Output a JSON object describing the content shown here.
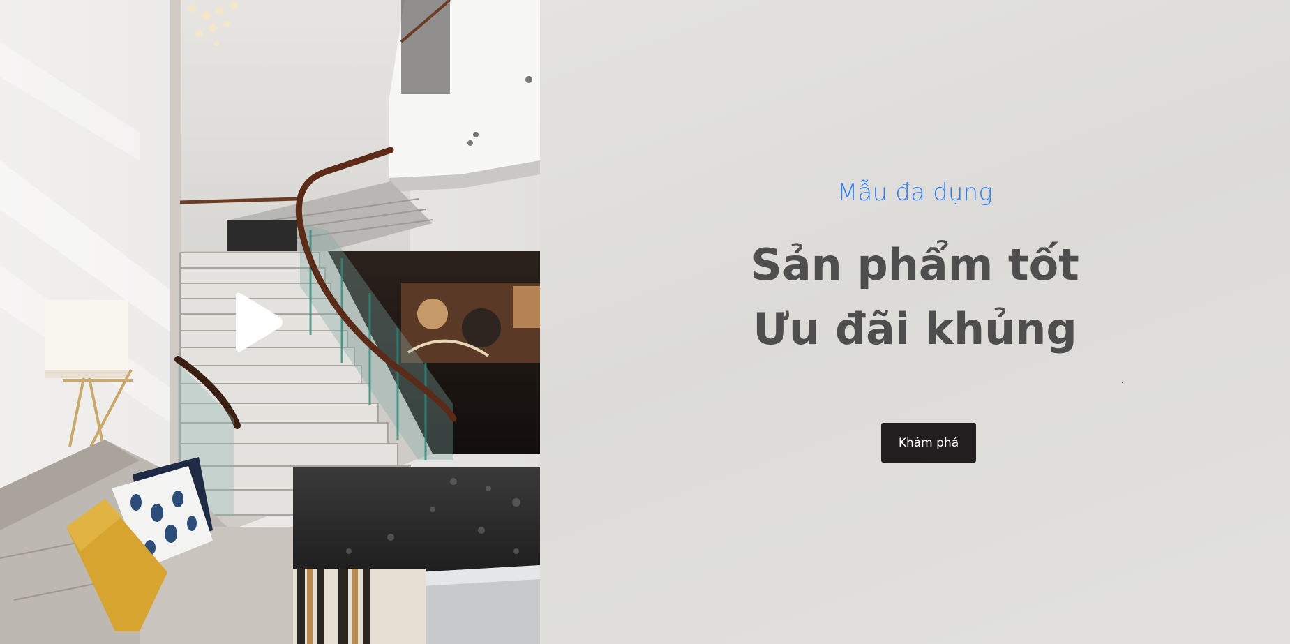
{
  "hero": {
    "subtitle": "Mẫu đa dụng",
    "headline_line1": "Sản phẩm tốt",
    "headline_line2": "Ưu đãi khủng",
    "cta_label": "Khám phá"
  },
  "colors": {
    "subtitle": "#2f7ff4",
    "headline": "#4e4e4e",
    "cta_background": "#231f20",
    "cta_text": "#ffffff",
    "hero_background": "#e0dfdc"
  },
  "media": {
    "photo_subject": "hotel lobby interior with staircase and sofa",
    "play_icon": "play-icon"
  }
}
